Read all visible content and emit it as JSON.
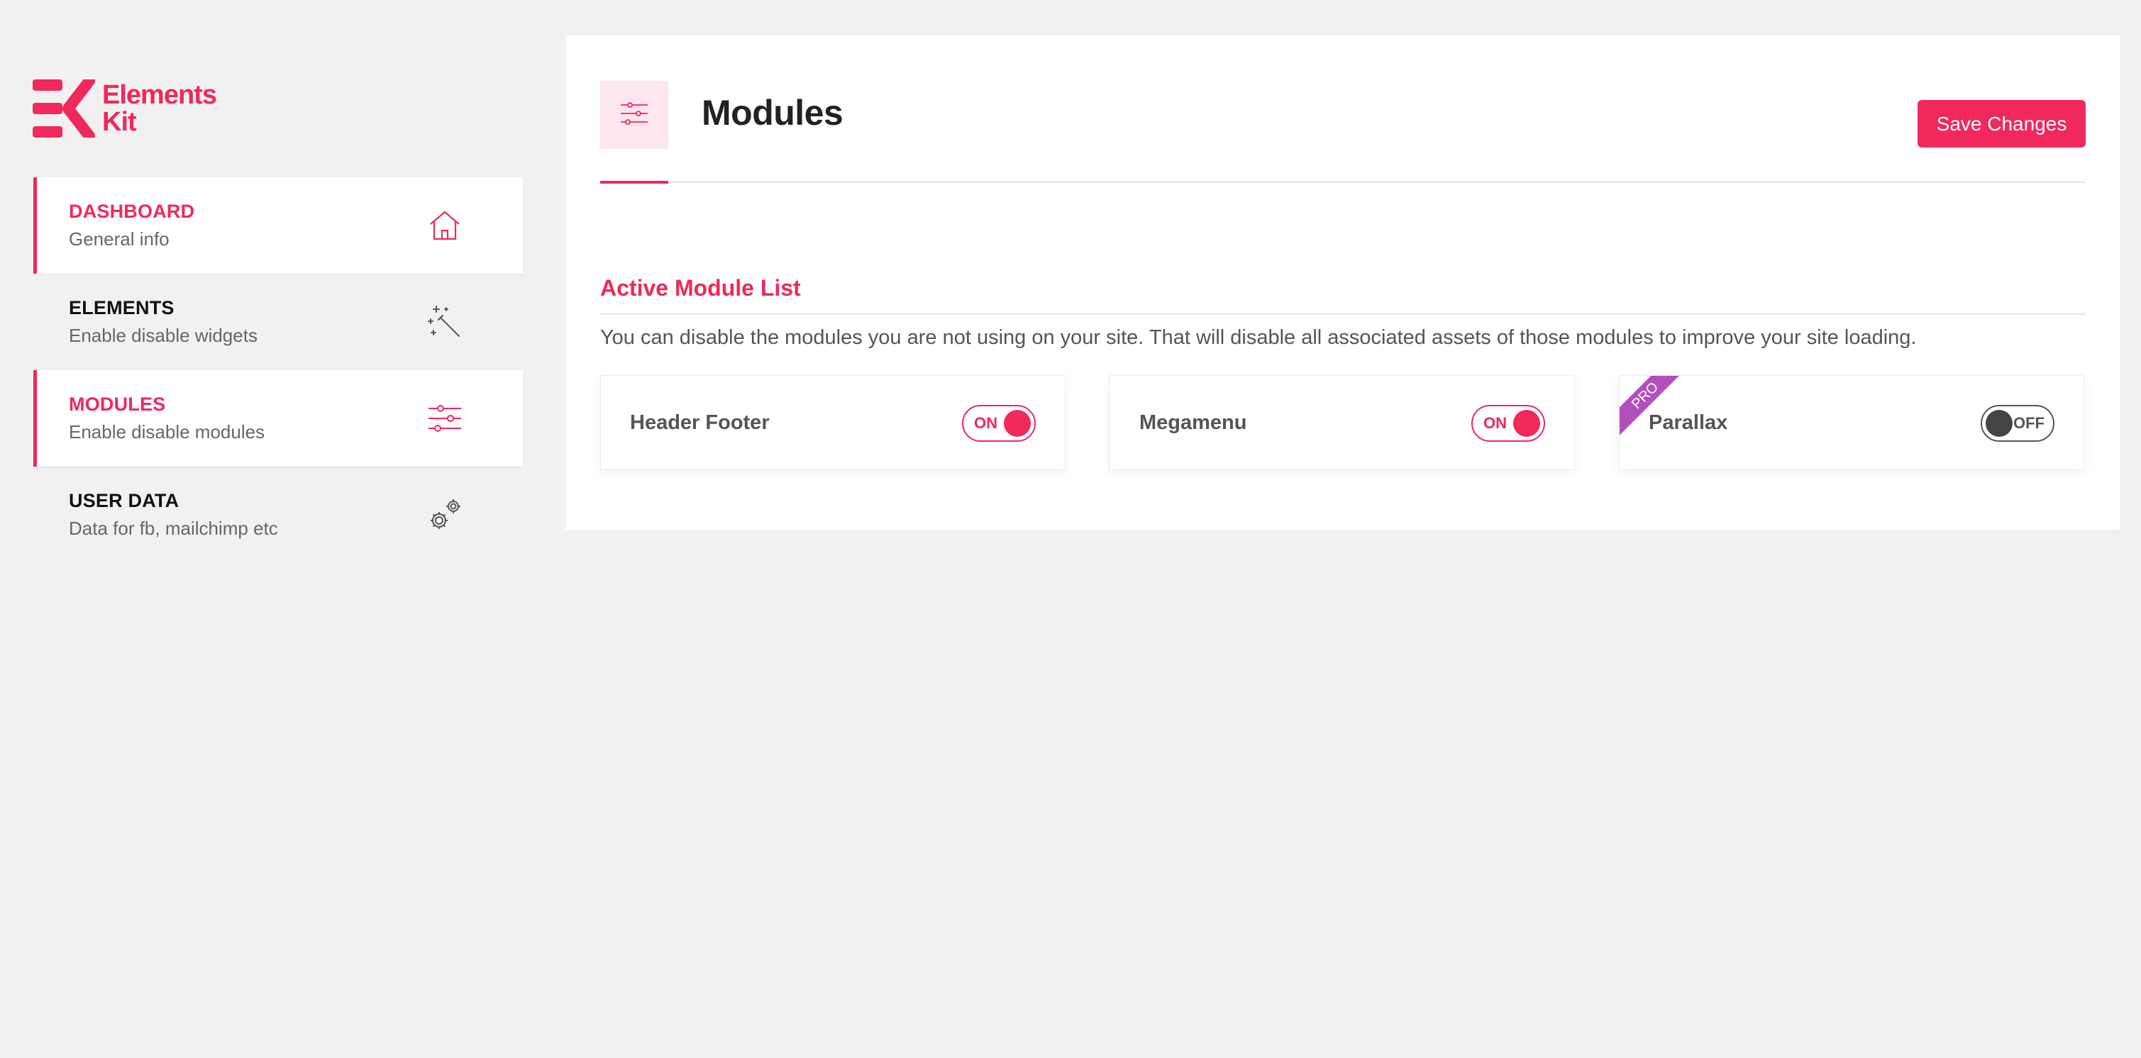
{
  "brand": {
    "line1": "Elements",
    "line2": "Kit",
    "accent_color": "#f0285c"
  },
  "sidebar": {
    "items": [
      {
        "title": "DASHBOARD",
        "subtitle": "General info",
        "icon": "home-icon",
        "active": true
      },
      {
        "title": "ELEMENTS",
        "subtitle": "Enable disable widgets",
        "icon": "magic-wand-icon",
        "active": false
      },
      {
        "title": "MODULES",
        "subtitle": "Enable disable modules",
        "icon": "sliders-icon",
        "active": true
      },
      {
        "title": "USER DATA",
        "subtitle": "Data for fb, mailchimp etc",
        "icon": "gears-icon",
        "active": false
      }
    ]
  },
  "header": {
    "icon": "sliders-icon",
    "title": "Modules",
    "save_label": "Save Changes"
  },
  "section": {
    "title": "Active Module List",
    "description": "You can disable the modules you are not using on your site. That will disable all associated assets of those modules to improve your site loading."
  },
  "modules": [
    {
      "name": "Header Footer",
      "state": "ON",
      "pro": false
    },
    {
      "name": "Megamenu",
      "state": "ON",
      "pro": false
    },
    {
      "name": "Parallax",
      "state": "OFF",
      "pro": true,
      "badge": "PRO"
    }
  ],
  "colors": {
    "pro_badge": "#b24fbd",
    "icon_box_bg": "#fde6ee"
  }
}
